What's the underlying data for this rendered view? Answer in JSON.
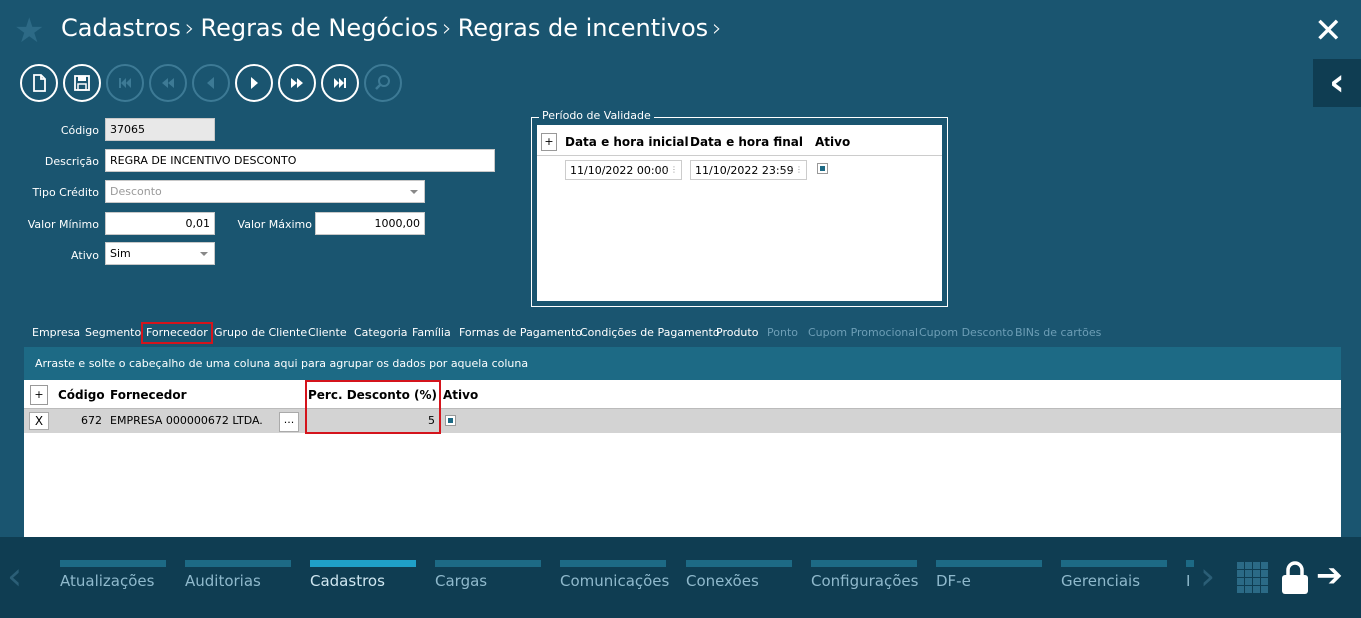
{
  "header": {
    "breadcrumbs": [
      "Cadastros",
      "Regras de Negócios",
      "Regras de incentivos"
    ],
    "separator": "›"
  },
  "form": {
    "codigo_label": "Código",
    "codigo_value": "37065",
    "descricao_label": "Descrição",
    "descricao_value": "REGRA DE INCENTIVO DESCONTO",
    "tipo_credito_label": "Tipo Crédito",
    "tipo_credito_value": "Desconto",
    "valor_minimo_label": "Valor Mínimo",
    "valor_minimo_value": "0,01",
    "valor_maximo_label": "Valor Máximo",
    "valor_maximo_value": "1000,00",
    "ativo_label": "Ativo",
    "ativo_value": "Sim"
  },
  "validity": {
    "legend": "Período de Validade",
    "add_label": "+",
    "columns": [
      "Data e hora inicial",
      "Data e hora final",
      "Ativo"
    ],
    "row": {
      "start": "11/10/2022 00:00",
      "end": "11/10/2022 23:59",
      "active": true
    }
  },
  "tabs": [
    {
      "label": "Empresa",
      "enabled": true
    },
    {
      "label": "Segmento",
      "enabled": true
    },
    {
      "label": "Fornecedor",
      "enabled": true,
      "active": true
    },
    {
      "label": "Grupo de Cliente",
      "enabled": true
    },
    {
      "label": "Cliente",
      "enabled": true
    },
    {
      "label": "Categoria",
      "enabled": true
    },
    {
      "label": "Família",
      "enabled": true
    },
    {
      "label": "Formas de Pagamento",
      "enabled": true
    },
    {
      "label": "Condições de Pagamento",
      "enabled": true
    },
    {
      "label": "Produto",
      "enabled": true
    },
    {
      "label": "Ponto",
      "enabled": false
    },
    {
      "label": "Cupom Promocional",
      "enabled": false
    },
    {
      "label": "Cupom Desconto",
      "enabled": false
    },
    {
      "label": "BINs de cartões",
      "enabled": false
    }
  ],
  "grid": {
    "group_hint": "Arraste e solte o cabeçalho de uma coluna aqui para agrupar os dados por aquela coluna",
    "add_label": "+",
    "columns": [
      "Código",
      "Fornecedor",
      "Perc. Desconto (%)",
      "Ativo"
    ],
    "rows": [
      {
        "delete_label": "X",
        "codigo": "672",
        "fornecedor": "EMPRESA 000000672 LTDA.",
        "lookup_label": "...",
        "perc_desconto": "5",
        "ativo": true
      }
    ]
  },
  "bottom_nav": {
    "items": [
      {
        "label": "Atualizações",
        "active": false
      },
      {
        "label": "Auditorias",
        "active": false
      },
      {
        "label": "Cadastros",
        "active": true
      },
      {
        "label": "Cargas",
        "active": false
      },
      {
        "label": "Comunicações",
        "active": false
      },
      {
        "label": "Conexões",
        "active": false
      },
      {
        "label": "Configurações",
        "active": false
      },
      {
        "label": "DF-e",
        "active": false
      },
      {
        "label": "Gerenciais",
        "active": false
      },
      {
        "label": "I",
        "active": false
      }
    ]
  },
  "colors": {
    "background": "#1a5570",
    "dark": "#0f3d52",
    "accent": "#1d6a85",
    "highlight": "#d4141c"
  }
}
